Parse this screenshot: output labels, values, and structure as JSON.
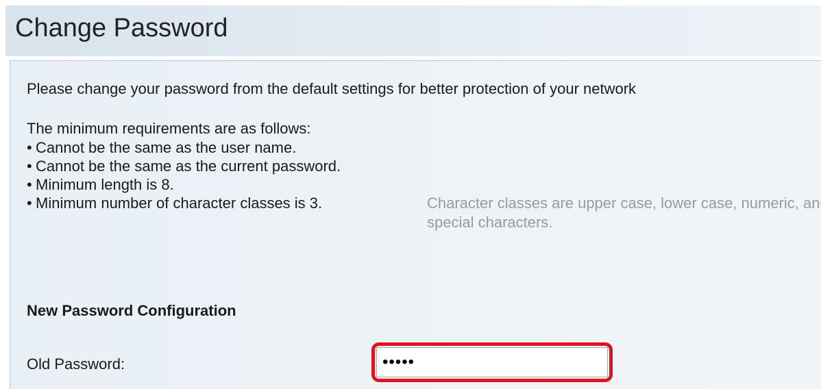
{
  "header": {
    "title": "Change Password"
  },
  "content": {
    "intro": "Please change your password from the default settings for better protection of your network",
    "requirements_heading": "The minimum requirements are as follows:",
    "bullet": "•",
    "requirements": [
      "Cannot be the same as the user name.",
      "Cannot be the same as the current password.",
      "Minimum length is 8.",
      "Minimum number of character classes is 3."
    ],
    "character_classes_note": "Character classes are upper case, lower case, numeric, and special characters."
  },
  "form": {
    "section_heading": "New Password Configuration",
    "old_password": {
      "label": "Old Password:",
      "value": "•••••"
    }
  },
  "colors": {
    "highlight": "#e0141c",
    "note_text": "#9a9a9a",
    "panel_background": "#eef3f7"
  }
}
